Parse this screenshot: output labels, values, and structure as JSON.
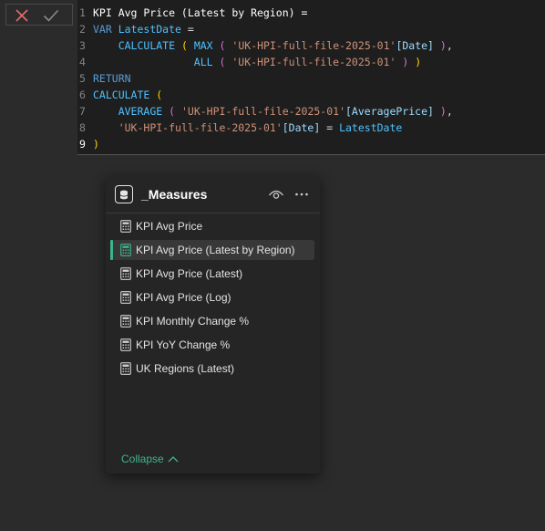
{
  "formula_bar": {
    "cancel_icon": "close-icon",
    "commit_icon": "check-icon",
    "lines": [
      {
        "num": "1"
      },
      {
        "num": "2"
      },
      {
        "num": "3"
      },
      {
        "num": "4"
      },
      {
        "num": "5"
      },
      {
        "num": "6"
      },
      {
        "num": "7"
      },
      {
        "num": "8"
      },
      {
        "num": "9"
      }
    ],
    "tokens": {
      "l1": "KPI Avg Price (Latest by Region) =",
      "l2_kw": "VAR",
      "l2_var": "LatestDate",
      "l2_eq": "=",
      "l3_fn": "CALCULATE",
      "l3_p1": "(",
      "l3_fn2": "MAX",
      "l3_p2": "(",
      "l3_str": "'UK-HPI-full-file-2025-01'",
      "l3_col": "[Date]",
      "l3_p3": ")",
      "l3_comma": ",",
      "l4_fn": "ALL",
      "l4_p1": "(",
      "l4_str": "'UK-HPI-full-file-2025-01'",
      "l4_p2": ")",
      "l4_p3": ")",
      "l5_kw": "RETURN",
      "l6_fn": "CALCULATE",
      "l6_p1": "(",
      "l7_fn": "AVERAGE",
      "l7_p1": "(",
      "l7_str": "'UK-HPI-full-file-2025-01'",
      "l7_col": "[AveragePrice]",
      "l7_p2": ")",
      "l7_comma": ",",
      "l8_str": "'UK-HPI-full-file-2025-01'",
      "l8_col": "[Date]",
      "l8_eq": "=",
      "l8_var": "LatestDate",
      "l9_p": ")"
    }
  },
  "panel": {
    "title": "_Measures",
    "table_icon": "database-icon",
    "eye_icon": "eye-icon",
    "more_icon": "more-icon",
    "items": [
      {
        "label": "KPI Avg Price",
        "selected": false
      },
      {
        "label": "KPI Avg Price (Latest by Region)",
        "selected": true
      },
      {
        "label": "KPI Avg Price (Latest)",
        "selected": false
      },
      {
        "label": "KPI Avg Price (Log)",
        "selected": false
      },
      {
        "label": "KPI Monthly Change %",
        "selected": false
      },
      {
        "label": "KPI YoY Change %",
        "selected": false
      },
      {
        "label": "UK Regions (Latest)",
        "selected": false
      }
    ],
    "collapse_label": "Collapse",
    "colors": {
      "accent": "#3fb68b",
      "selected_bg": "#383838"
    }
  }
}
